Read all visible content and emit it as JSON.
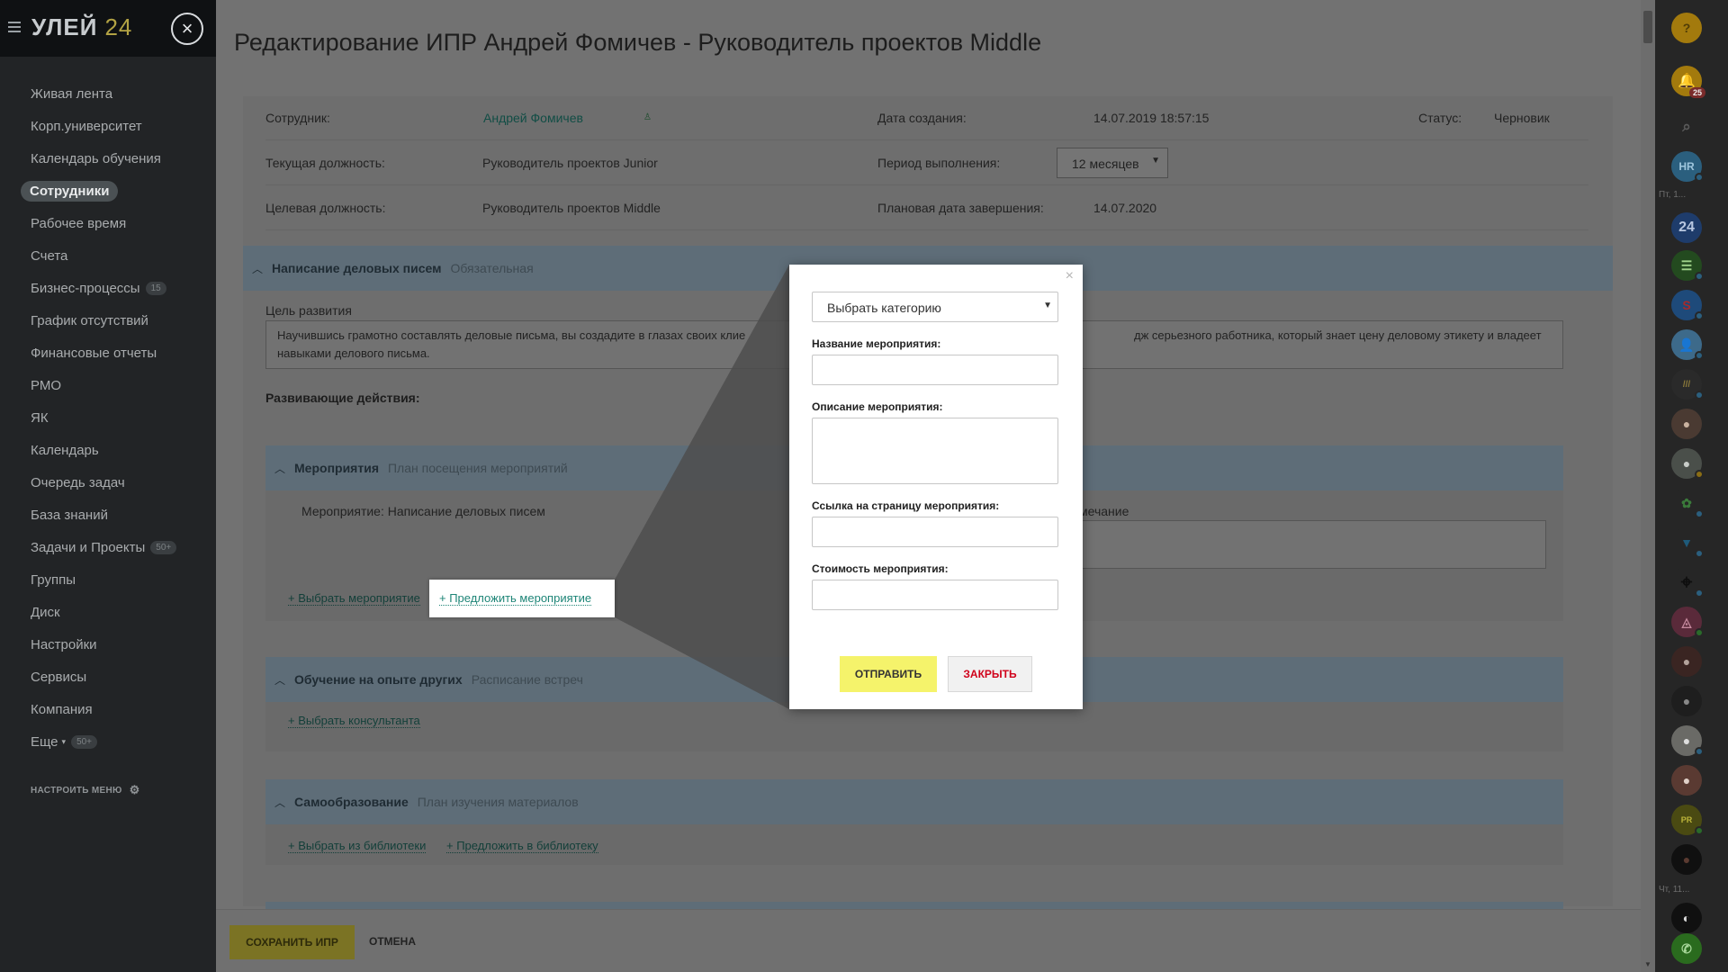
{
  "brand": {
    "name": "УЛЕЙ",
    "num": "24"
  },
  "sidebar": {
    "items": [
      {
        "label": "Живая лента"
      },
      {
        "label": "Корп.университет"
      },
      {
        "label": "Календарь обучения"
      },
      {
        "label": "Сотрудники",
        "active": true
      },
      {
        "label": "Рабочее время"
      },
      {
        "label": "Счета"
      },
      {
        "label": "Бизнес-процессы",
        "badge": "15"
      },
      {
        "label": "График отсутствий"
      },
      {
        "label": "Финансовые отчеты"
      },
      {
        "label": "РМО"
      },
      {
        "label": "ЯК"
      },
      {
        "label": "Календарь"
      },
      {
        "label": "Очередь задач"
      },
      {
        "label": "База знаний"
      },
      {
        "label": "Задачи и Проекты",
        "badge": "50+"
      },
      {
        "label": "Группы"
      },
      {
        "label": "Диск"
      },
      {
        "label": "Настройки"
      },
      {
        "label": "Сервисы"
      },
      {
        "label": "Компания"
      },
      {
        "label": "Еще",
        "badge": "50+",
        "caret": "▾"
      }
    ],
    "configure": "НАСТРОИТЬ МЕНЮ"
  },
  "page": {
    "title": "Редактирование ИПР Андрей Фомичев - Руководитель проектов Middle",
    "employee_label": "Сотрудник:",
    "employee_name": "Андрей Фомичев",
    "created_label": "Дата создания:",
    "created_value": "14.07.2019 18:57:15",
    "status_label": "Статус:",
    "status_value": "Черновик",
    "current_pos_label": "Текущая должность:",
    "current_pos_value": "Руководитель проектов Junior",
    "period_label": "Период выполнения:",
    "period_value": "12 месяцев",
    "target_pos_label": "Целевая должность:",
    "target_pos_value": "Руководитель проектов Middle",
    "planned_end_label": "Плановая дата завершения:",
    "planned_end_value": "14.07.2020"
  },
  "competency": {
    "title": "Написание деловых писем",
    "tag": "Обязательная",
    "goal_label": "Цель развития",
    "goal_text_1": "Научившись грамотно составлять деловые письма, вы создадите в глазах своих клие",
    "goal_text_2": "дж серьезного работника, который знает цену деловому этикету и владеет",
    "goal_text_3": "навыками делового письма.",
    "actions_label": "Развивающие действия:"
  },
  "events": {
    "title": "Мероприятия",
    "subtitle": "План посещения мероприятий",
    "item": "Мероприятие: Написание деловых писем",
    "note_label": "мечание",
    "choose_link": "+ Выбрать мероприятие",
    "propose_link": "+ Предложить мероприятие"
  },
  "learning": {
    "title": "Обучение на опыте других",
    "subtitle": "Расписание встреч",
    "link": "+ Выбрать консультанта"
  },
  "self_ed": {
    "title": "Самообразование",
    "subtitle": "План изучения материалов",
    "link1": "+ Выбрать из библиотеки",
    "link2": "+ Предложить в библиотеку"
  },
  "modal": {
    "close": "×",
    "category_placeholder": "Выбрать категорию",
    "name_label": "Название мероприятия:",
    "desc_label": "Описание мероприятия:",
    "url_label": "Ссылка на страницу мероприятия:",
    "cost_label": "Стоимость мероприятия:",
    "send": "ОТПРАВИТЬ",
    "close_btn": "ЗАКРЫТЬ"
  },
  "footer": {
    "save": "СОХРАНИТЬ ИПР",
    "cancel": "ОТМЕНА"
  },
  "rightbar": {
    "help": "?",
    "notif_count": "25",
    "hr": "HR",
    "b24": "24",
    "date1": "Пт, 1...",
    "date2": "Чт, 11...",
    "pr": "PR"
  },
  "colors": {
    "accent_yellow": "#f5f36b",
    "link_teal": "#1e8577",
    "close_red": "#d0021b",
    "section_blue": "#a9cce3"
  }
}
